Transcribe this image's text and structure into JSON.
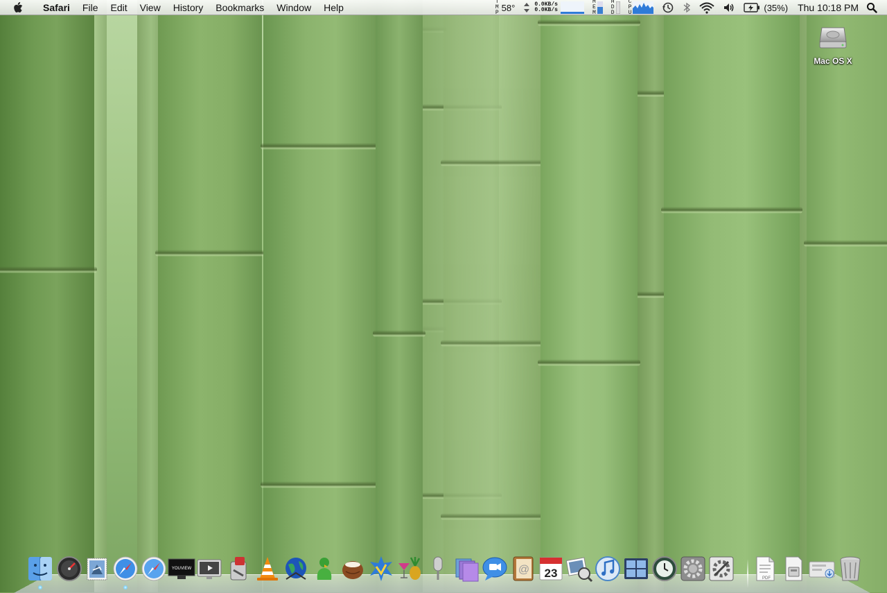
{
  "menubar": {
    "app_name": "Safari",
    "menus": [
      "File",
      "Edit",
      "View",
      "History",
      "Bookmarks",
      "Window",
      "Help"
    ],
    "temperature": {
      "label_letters": [
        "T",
        "M",
        "P"
      ],
      "value": "58°"
    },
    "network": {
      "up": "0.0KB/s",
      "down": "0.0KB/s"
    },
    "memory_label_letters": [
      "M",
      "E",
      "M"
    ],
    "disk_label_letters": [
      "H",
      "D",
      "D"
    ],
    "cpu_label_letters": [
      "C",
      "P",
      "U"
    ],
    "battery_percent": "(35%)",
    "clock": "Thu 10:18 PM",
    "icons": [
      "apple-icon",
      "updown-arrows-icon",
      "network-graph-icon",
      "memory-graph-icon",
      "disk-graph-icon",
      "cpu-graph-icon",
      "time-machine-icon",
      "bluetooth-icon",
      "wifi-icon",
      "volume-icon",
      "battery-icon",
      "spotlight-icon"
    ]
  },
  "desktop": {
    "volume_label": "Mac OS X"
  },
  "dock": {
    "apps": [
      {
        "name": "Finder",
        "icon": "finder-icon",
        "running": true
      },
      {
        "name": "Dashboard",
        "icon": "dashboard-icon",
        "running": false
      },
      {
        "name": "Mail",
        "icon": "mail-stamp-icon",
        "running": false
      },
      {
        "name": "Safari",
        "icon": "safari-compass-icon",
        "running": true
      },
      {
        "name": "Safari (copy)",
        "icon": "safari-compass-icon",
        "running": false
      },
      {
        "name": "YouView",
        "icon": "monitor-icon",
        "running": false
      },
      {
        "name": "Front Row",
        "icon": "frontrow-icon",
        "running": false
      },
      {
        "name": "Automator",
        "icon": "automator-icon",
        "running": false
      },
      {
        "name": "VLC",
        "icon": "vlc-cone-icon",
        "running": false
      },
      {
        "name": "Globe",
        "icon": "globe-icon",
        "running": false
      },
      {
        "name": "Adium",
        "icon": "adium-duck-icon",
        "running": false
      },
      {
        "name": "Coconut",
        "icon": "coconut-icon",
        "running": false
      },
      {
        "name": "Chat",
        "icon": "chat-burst-icon",
        "running": false
      },
      {
        "name": "Cocktail",
        "icon": "cocktail-pineapple-icon",
        "running": false
      },
      {
        "name": "Microphone",
        "icon": "microphone-icon",
        "running": false
      },
      {
        "name": "Spaces",
        "icon": "spaces-icon",
        "running": false
      },
      {
        "name": "iChat",
        "icon": "ichat-bubble-icon",
        "running": false
      },
      {
        "name": "Address Book",
        "icon": "address-book-icon",
        "running": false
      },
      {
        "name": "iCal",
        "icon": "calendar-icon",
        "running": false
      },
      {
        "name": "Preview",
        "icon": "preview-photos-icon",
        "running": false
      },
      {
        "name": "iTunes",
        "icon": "itunes-note-icon",
        "running": false
      },
      {
        "name": "Spaces 2",
        "icon": "spaces-grid-icon",
        "running": false
      },
      {
        "name": "Time Machine",
        "icon": "time-machine-icon",
        "running": false
      },
      {
        "name": "System Preferences",
        "icon": "gear-icon",
        "running": false
      },
      {
        "name": "Utility",
        "icon": "utility-gear-icon",
        "running": false
      }
    ],
    "stacks": [
      {
        "name": "PDF",
        "icon": "pdf-document-icon"
      },
      {
        "name": "Disk Image",
        "icon": "disk-image-icon"
      },
      {
        "name": "Downloads",
        "icon": "downloads-icon"
      },
      {
        "name": "Trash",
        "icon": "trash-icon"
      }
    ],
    "calendar_day": "23",
    "monitor_text": "YOUVIEW",
    "colors": {
      "running_indicator": "#7fd4ff",
      "accent_blue": "#2f7bd8"
    }
  }
}
